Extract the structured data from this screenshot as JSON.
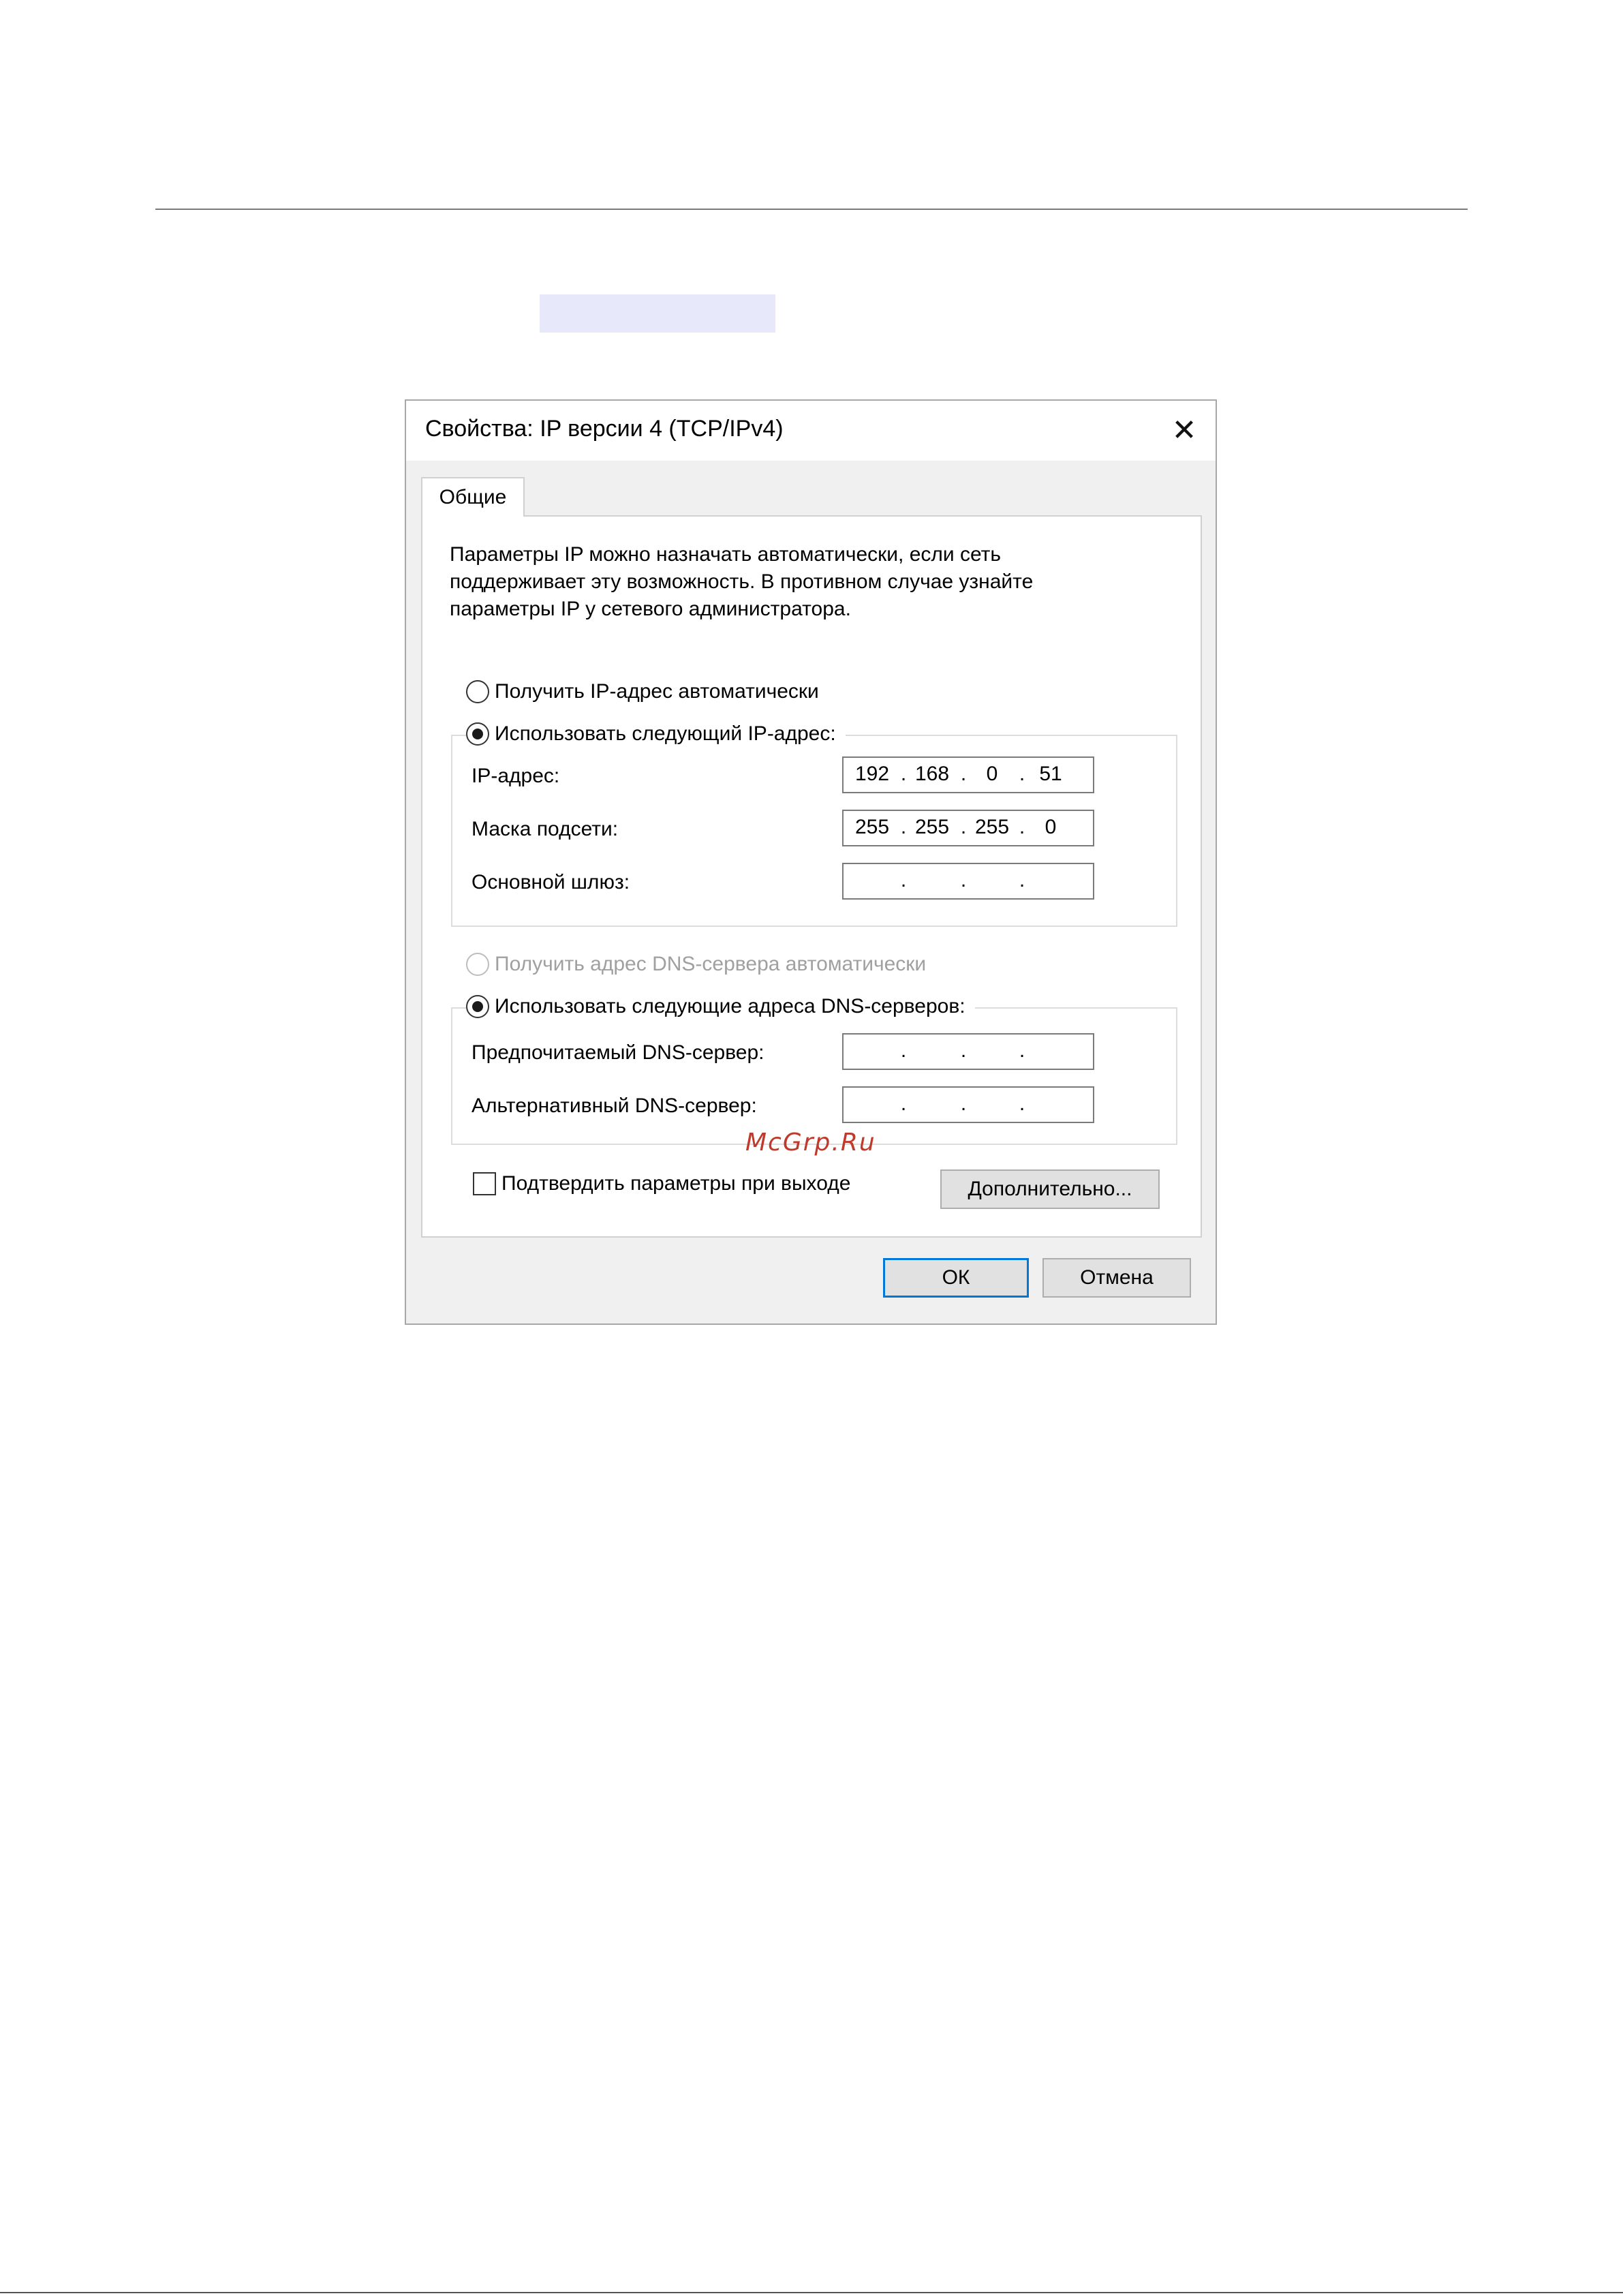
{
  "dialog": {
    "title": "Свойства: IP версии 4 (TCP/IPv4)",
    "close_glyph": "✕",
    "tab_label": "Общие",
    "description": [
      "Параметры IP можно назначать автоматически, если сеть",
      "поддерживает эту возможность. В противном случае узнайте",
      "параметры IP у сетевого администратора."
    ],
    "ip_mode": {
      "auto_label": "Получить IP-адрес автоматически",
      "manual_label": "Использовать следующий IP-адрес:",
      "selected": "manual"
    },
    "ip_fields": {
      "ip": {
        "label": "IP-адрес:",
        "octets": [
          "192",
          "168",
          "0",
          "51"
        ]
      },
      "mask": {
        "label": "Маска подсети:",
        "octets": [
          "255",
          "255",
          "255",
          "0"
        ]
      },
      "gateway": {
        "label": "Основной шлюз:",
        "octets": [
          "",
          "",
          "",
          ""
        ]
      }
    },
    "dns_mode": {
      "auto_label": "Получить адрес DNS-сервера автоматически",
      "auto_disabled": true,
      "manual_label": "Использовать следующие адреса DNS-серверов:",
      "selected": "manual"
    },
    "dns_fields": {
      "preferred": {
        "label": "Предпочитаемый DNS-сервер:",
        "octets": [
          "",
          "",
          "",
          ""
        ]
      },
      "alternate": {
        "label": "Альтернативный DNS-сервер:",
        "octets": [
          "",
          "",
          "",
          ""
        ]
      }
    },
    "validate_checkbox": {
      "label": "Подтвердить параметры при выходе",
      "checked": false
    },
    "advanced_button": "Дополнительно...",
    "ok_button": "ОК",
    "cancel_button": "Отмена"
  },
  "watermark": "McGrp.Ru",
  "icons": {
    "close": "close-icon",
    "radio": "radio-button",
    "checkbox": "checkbox"
  },
  "colors": {
    "focus_border": "#0078d7",
    "dialog_bg": "#f0f0f0",
    "watermark": "#c0392b"
  }
}
